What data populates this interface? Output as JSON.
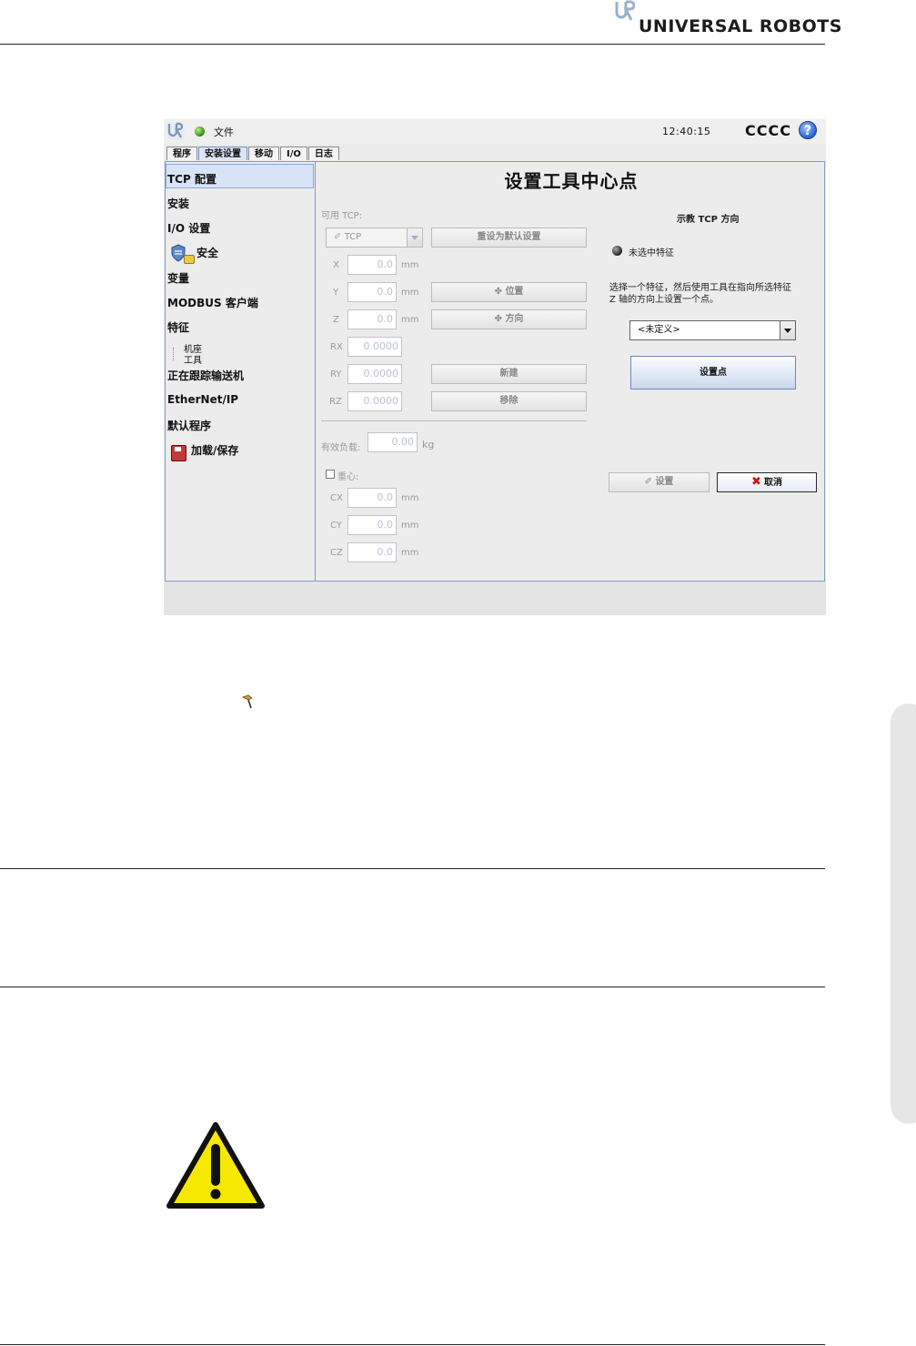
{
  "brand": {
    "name": "UNIVERSAL ROBOTS"
  },
  "topbar": {
    "file_menu": "文件",
    "clock": "12:40:15",
    "robot_name": "CCCC",
    "help": "?"
  },
  "tabs": [
    "程序",
    "安装设置",
    "移动",
    "I/O",
    "日志"
  ],
  "sidebar": {
    "items": [
      "TCP 配置",
      "安装",
      "I/O 设置",
      "安全",
      "变量",
      "MODBUS 客户端",
      "特征",
      "正在跟踪输送机",
      "EtherNet/IP",
      "默认程序",
      "加载/保存"
    ],
    "feature_children": [
      "机座",
      "工具"
    ]
  },
  "main": {
    "title": "设置工具中心点",
    "available_tcp_label": "可用 TCP:",
    "tcp_select": "TCP",
    "reset_button": "重设为默认设置",
    "position_button": "位置",
    "orientation_button": "方向",
    "new_button": "新建",
    "remove_button": "移除",
    "fields": [
      {
        "label": "X",
        "value": "0.0",
        "unit": "mm"
      },
      {
        "label": "Y",
        "value": "0.0",
        "unit": "mm"
      },
      {
        "label": "Z",
        "value": "0.0",
        "unit": "mm"
      },
      {
        "label": "RX",
        "value": "0.0000",
        "unit": ""
      },
      {
        "label": "RY",
        "value": "0.0000",
        "unit": ""
      },
      {
        "label": "RZ",
        "value": "0.0000",
        "unit": ""
      }
    ],
    "payload_label": "有效负载:",
    "payload_value": "0.00",
    "payload_unit": "kg",
    "cog_label": "重心:",
    "cog_fields": [
      {
        "label": "CX",
        "value": "0.0",
        "unit": "mm"
      },
      {
        "label": "CY",
        "value": "0.0",
        "unit": "mm"
      },
      {
        "label": "CZ",
        "value": "0.0",
        "unit": "mm"
      }
    ]
  },
  "teach": {
    "heading": "示教 TCP 方向",
    "radio_label": "未选中特征",
    "instruction_line1": "选择一个特征，然后使用工具在指向所选特征",
    "instruction_line2": "Z 轴的方向上设置一个点。",
    "feature_select": "<未定义>",
    "set_point_button": "设置点",
    "set_button": "设置",
    "cancel_button": "取消"
  }
}
